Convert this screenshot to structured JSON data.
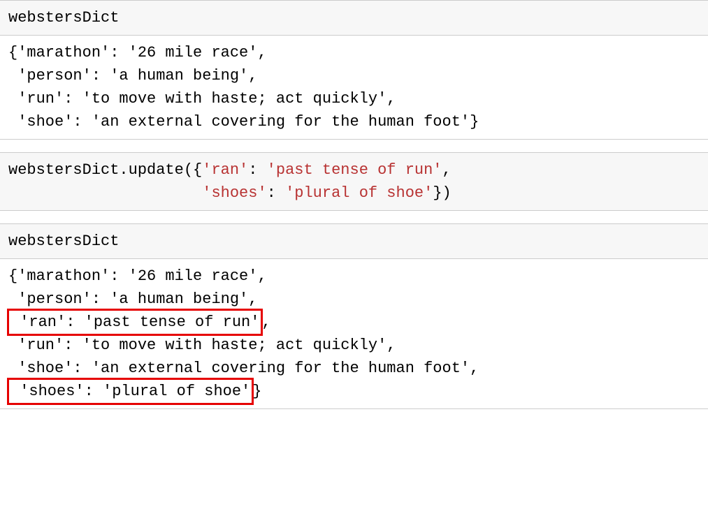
{
  "cells": {
    "c1_input": "webstersDict",
    "c1_output_l1": "{'marathon': '26 mile race',",
    "c1_output_l2": " 'person': 'a human being',",
    "c1_output_l3": " 'run': 'to move with haste; act quickly',",
    "c1_output_l4": " 'shoe': 'an external covering for the human foot'}",
    "c2_prefix": "webstersDict.update({",
    "c2_s1": "'ran'",
    "c2_sep": ": ",
    "c2_s2": "'past tense of run'",
    "c2_comma": ",",
    "c2_indent": "                     ",
    "c2_s3": "'shoes'",
    "c2_s4": "'plural of shoe'",
    "c2_close": "})",
    "c3_input": "webstersDict",
    "c3_l1": "{'marathon': '26 mile race',",
    "c3_l2": " 'person': 'a human being',",
    "c3_hl1": " 'ran': 'past tense of run'",
    "c3_hl1_after": ",",
    "c3_l4": " 'run': 'to move with haste; act quickly',",
    "c3_l5": " 'shoe': 'an external covering for the human foot',",
    "c3_hl2": " 'shoes': 'plural of shoe'",
    "c3_hl2_after": "}"
  }
}
